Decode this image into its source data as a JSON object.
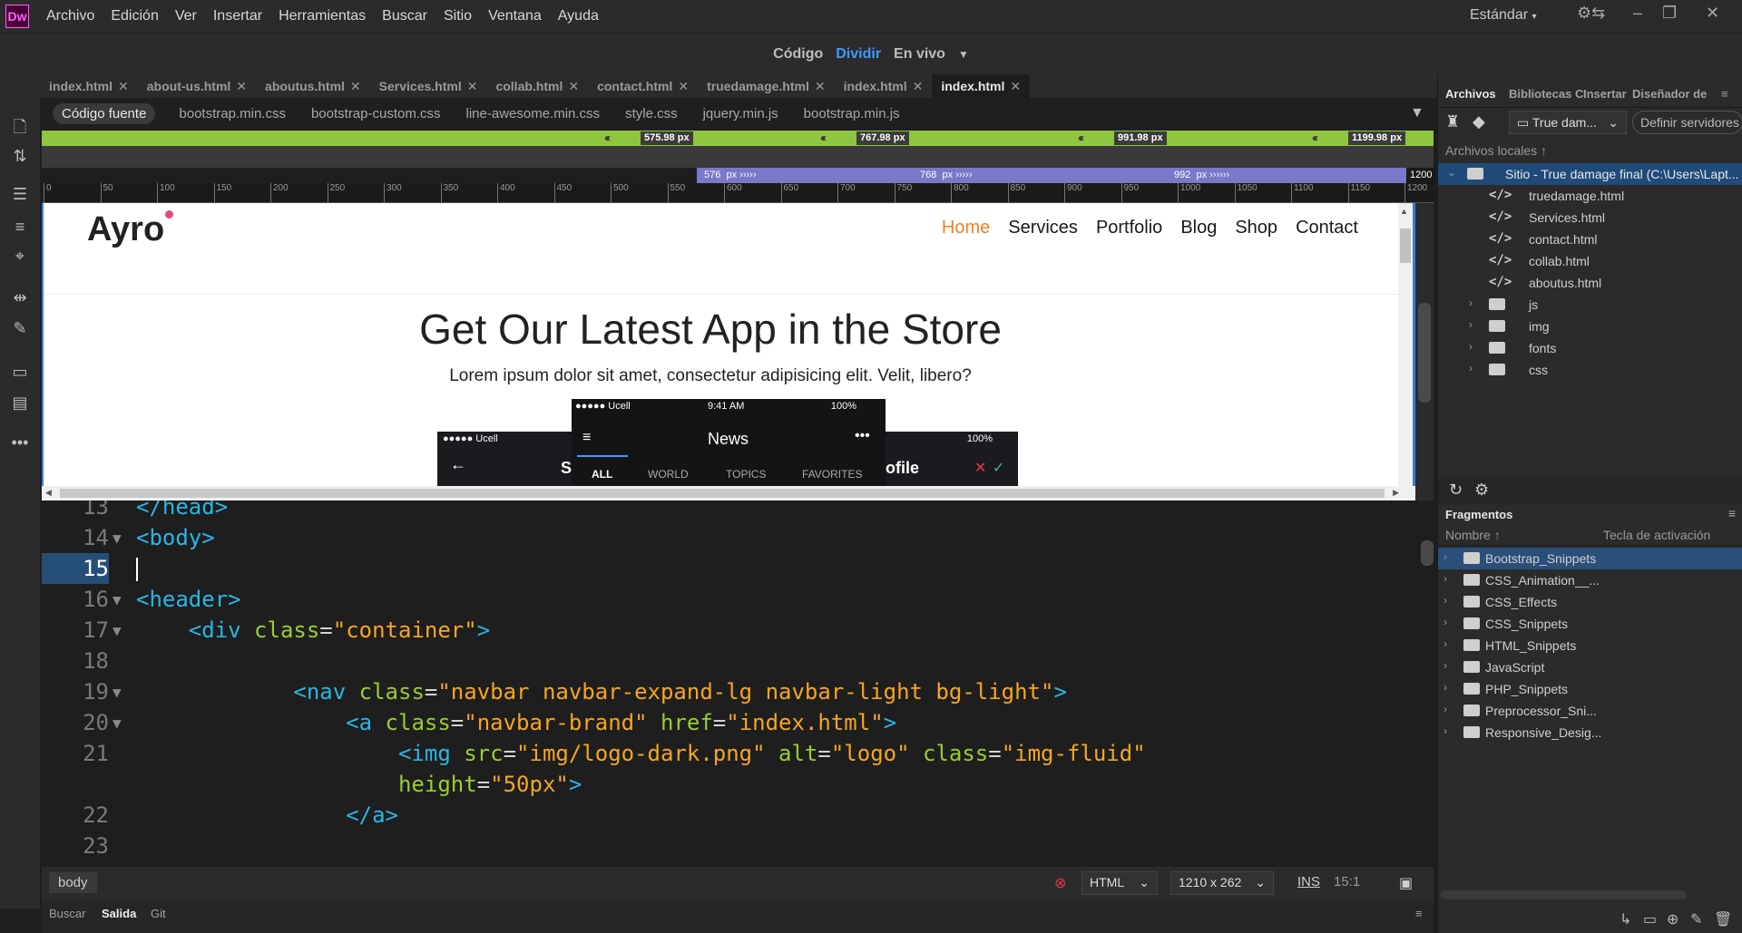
{
  "app": {
    "logo": "Dw"
  },
  "menu": [
    "Archivo",
    "Edición",
    "Ver",
    "Insertar",
    "Herramientas",
    "Buscar",
    "Sitio",
    "Ventana",
    "Ayuda"
  ],
  "workspace": "Estándar",
  "views": {
    "code": "Código",
    "split": "Dividir",
    "live": "En vivo"
  },
  "doc_tabs": [
    {
      "label": "index.html"
    },
    {
      "label": "about-us.html"
    },
    {
      "label": "aboutus.html"
    },
    {
      "label": "Services.html"
    },
    {
      "label": "collab.html"
    },
    {
      "label": "contact.html"
    },
    {
      "label": "truedamage.html"
    },
    {
      "label": "index.html"
    },
    {
      "label": "index.html",
      "active": true
    }
  ],
  "related_files": {
    "source": "Código fuente",
    "files": [
      "bootstrap.min.css",
      "bootstrap-custom.css",
      "line-awesome.min.css",
      "style.css",
      "jquery.min.js",
      "bootstrap.min.js"
    ]
  },
  "media_queries": {
    "max": [
      "575.98",
      "767.98",
      "991.98",
      "1199.98"
    ],
    "min": [
      "576",
      "768",
      "992",
      "1200"
    ],
    "unit": "px"
  },
  "ruler": [
    "0",
    "50",
    "100",
    "150",
    "200",
    "250",
    "300",
    "350",
    "400",
    "450",
    "500",
    "550",
    "600",
    "650",
    "700",
    "750",
    "800",
    "850",
    "900",
    "950",
    "1000",
    "1050",
    "1100",
    "1150",
    "1200"
  ],
  "live": {
    "logo": "Ayro",
    "nav": [
      "Home",
      "Services",
      "Portfolio",
      "Blog",
      "Shop",
      "Contact"
    ],
    "title": "Get Our Latest App in the Store",
    "subtitle": "Lorem ipsum dolor sit amet, consectetur adipisicing elit. Velit, libero?",
    "phone_back": {
      "carrier": "●●●●● Ucell",
      "battery": "100%",
      "title_partial_left": "S",
      "title_partial_right": "ofile"
    },
    "phone_front": {
      "carrier": "●●●●● Ucell",
      "time": "9:41 AM",
      "battery": "100%",
      "title": "News",
      "tabs": [
        "ALL",
        "WORLD",
        "TOPICS",
        "FAVORITES"
      ]
    }
  },
  "code": [
    {
      "n": "13",
      "fold": false,
      "parts": [
        [
          "t",
          "</head>"
        ]
      ]
    },
    {
      "n": "14",
      "fold": true,
      "parts": [
        [
          "t",
          "<body>"
        ]
      ]
    },
    {
      "n": "15",
      "fold": false,
      "current": true,
      "parts": []
    },
    {
      "n": "16",
      "fold": true,
      "parts": [
        [
          "t",
          "<header>"
        ]
      ]
    },
    {
      "n": "17",
      "fold": true,
      "parts": [
        [
          "p",
          "    "
        ],
        [
          "t",
          "<div "
        ],
        [
          "a",
          "class"
        ],
        [
          "p",
          "="
        ],
        [
          "v",
          "\"container\""
        ],
        [
          "t",
          ">"
        ]
      ]
    },
    {
      "n": "18",
      "fold": false,
      "parts": []
    },
    {
      "n": "19",
      "fold": true,
      "parts": [
        [
          "p",
          "            "
        ],
        [
          "t",
          "<nav "
        ],
        [
          "a",
          "class"
        ],
        [
          "p",
          "="
        ],
        [
          "v",
          "\"navbar navbar-expand-lg navbar-light bg-light\""
        ],
        [
          "t",
          ">"
        ]
      ]
    },
    {
      "n": "20",
      "fold": true,
      "parts": [
        [
          "p",
          "                "
        ],
        [
          "t",
          "<a "
        ],
        [
          "a",
          "class"
        ],
        [
          "p",
          "="
        ],
        [
          "v",
          "\"navbar-brand\" "
        ],
        [
          "a",
          "href"
        ],
        [
          "p",
          "="
        ],
        [
          "v",
          "\"index.html\""
        ],
        [
          "t",
          ">"
        ]
      ]
    },
    {
      "n": "21",
      "fold": false,
      "parts": [
        [
          "p",
          "                    "
        ],
        [
          "t",
          "<img "
        ],
        [
          "a",
          "src"
        ],
        [
          "p",
          "="
        ],
        [
          "v",
          "\"img/logo-dark.png\" "
        ],
        [
          "a",
          "alt"
        ],
        [
          "p",
          "="
        ],
        [
          "v",
          "\"logo\" "
        ],
        [
          "a",
          "class"
        ],
        [
          "p",
          "="
        ],
        [
          "v",
          "\"img-fluid\""
        ]
      ]
    },
    {
      "n": "",
      "fold": false,
      "parts": [
        [
          "p",
          "                    "
        ],
        [
          "a",
          "height"
        ],
        [
          "p",
          "="
        ],
        [
          "v",
          "\"50px\""
        ],
        [
          "t",
          ">"
        ]
      ]
    },
    {
      "n": "22",
      "fold": false,
      "parts": [
        [
          "p",
          "                "
        ],
        [
          "t",
          "</a>"
        ]
      ]
    },
    {
      "n": "23",
      "fold": false,
      "parts": []
    }
  ],
  "status": {
    "tag": "body",
    "language": "HTML",
    "size": "1210 x 262",
    "mode": "INS",
    "position": "15:1"
  },
  "bottom_tabs": [
    "Buscar",
    "Salida",
    "Git"
  ],
  "files_panel": {
    "tabs": [
      "Archivos",
      "Bibliotecas C",
      "Insertar",
      "Diseñador de"
    ],
    "site_select": "True dam...",
    "define_servers": "Definir servidores",
    "local_label": "Archivos locales",
    "root": "Sitio - True damage final (C:\\Users\\Lapt...",
    "items": [
      {
        "type": "file",
        "name": "truedamage.html"
      },
      {
        "type": "file",
        "name": "Services.html"
      },
      {
        "type": "file",
        "name": "contact.html"
      },
      {
        "type": "file",
        "name": "collab.html"
      },
      {
        "type": "file",
        "name": "aboutus.html"
      },
      {
        "type": "folder",
        "name": "js"
      },
      {
        "type": "folder",
        "name": "img"
      },
      {
        "type": "folder",
        "name": "fonts"
      },
      {
        "type": "folder",
        "name": "css"
      }
    ]
  },
  "snippets_panel": {
    "title": "Fragmentos",
    "col_name": "Nombre",
    "col_key": "Tecla de activación",
    "items": [
      "Bootstrap_Snippets",
      "CSS_Animation__...",
      "CSS_Effects",
      "CSS_Snippets",
      "HTML_Snippets",
      "JavaScript",
      "PHP_Snippets",
      "Preprocessor_Sni...",
      "Responsive_Desig..."
    ]
  },
  "colors": {
    "accent": "#3b9cff",
    "mq_max": "#8ec63f",
    "mq_min": "#7b77c9",
    "home_link": "#f17e24"
  }
}
